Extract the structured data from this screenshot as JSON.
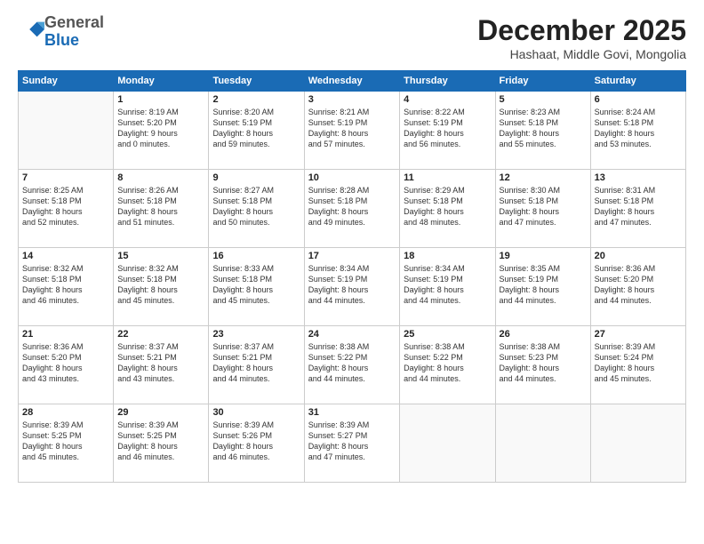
{
  "logo": {
    "general": "General",
    "blue": "Blue"
  },
  "header": {
    "title": "December 2025",
    "subtitle": "Hashaat, Middle Govi, Mongolia"
  },
  "calendar": {
    "columns": [
      "Sunday",
      "Monday",
      "Tuesday",
      "Wednesday",
      "Thursday",
      "Friday",
      "Saturday"
    ],
    "weeks": [
      [
        {
          "day": "",
          "info": ""
        },
        {
          "day": "1",
          "info": "Sunrise: 8:19 AM\nSunset: 5:20 PM\nDaylight: 9 hours\nand 0 minutes."
        },
        {
          "day": "2",
          "info": "Sunrise: 8:20 AM\nSunset: 5:19 PM\nDaylight: 8 hours\nand 59 minutes."
        },
        {
          "day": "3",
          "info": "Sunrise: 8:21 AM\nSunset: 5:19 PM\nDaylight: 8 hours\nand 57 minutes."
        },
        {
          "day": "4",
          "info": "Sunrise: 8:22 AM\nSunset: 5:19 PM\nDaylight: 8 hours\nand 56 minutes."
        },
        {
          "day": "5",
          "info": "Sunrise: 8:23 AM\nSunset: 5:18 PM\nDaylight: 8 hours\nand 55 minutes."
        },
        {
          "day": "6",
          "info": "Sunrise: 8:24 AM\nSunset: 5:18 PM\nDaylight: 8 hours\nand 53 minutes."
        }
      ],
      [
        {
          "day": "7",
          "info": "Sunrise: 8:25 AM\nSunset: 5:18 PM\nDaylight: 8 hours\nand 52 minutes."
        },
        {
          "day": "8",
          "info": "Sunrise: 8:26 AM\nSunset: 5:18 PM\nDaylight: 8 hours\nand 51 minutes."
        },
        {
          "day": "9",
          "info": "Sunrise: 8:27 AM\nSunset: 5:18 PM\nDaylight: 8 hours\nand 50 minutes."
        },
        {
          "day": "10",
          "info": "Sunrise: 8:28 AM\nSunset: 5:18 PM\nDaylight: 8 hours\nand 49 minutes."
        },
        {
          "day": "11",
          "info": "Sunrise: 8:29 AM\nSunset: 5:18 PM\nDaylight: 8 hours\nand 48 minutes."
        },
        {
          "day": "12",
          "info": "Sunrise: 8:30 AM\nSunset: 5:18 PM\nDaylight: 8 hours\nand 47 minutes."
        },
        {
          "day": "13",
          "info": "Sunrise: 8:31 AM\nSunset: 5:18 PM\nDaylight: 8 hours\nand 47 minutes."
        }
      ],
      [
        {
          "day": "14",
          "info": "Sunrise: 8:32 AM\nSunset: 5:18 PM\nDaylight: 8 hours\nand 46 minutes."
        },
        {
          "day": "15",
          "info": "Sunrise: 8:32 AM\nSunset: 5:18 PM\nDaylight: 8 hours\nand 45 minutes."
        },
        {
          "day": "16",
          "info": "Sunrise: 8:33 AM\nSunset: 5:18 PM\nDaylight: 8 hours\nand 45 minutes."
        },
        {
          "day": "17",
          "info": "Sunrise: 8:34 AM\nSunset: 5:19 PM\nDaylight: 8 hours\nand 44 minutes."
        },
        {
          "day": "18",
          "info": "Sunrise: 8:34 AM\nSunset: 5:19 PM\nDaylight: 8 hours\nand 44 minutes."
        },
        {
          "day": "19",
          "info": "Sunrise: 8:35 AM\nSunset: 5:19 PM\nDaylight: 8 hours\nand 44 minutes."
        },
        {
          "day": "20",
          "info": "Sunrise: 8:36 AM\nSunset: 5:20 PM\nDaylight: 8 hours\nand 44 minutes."
        }
      ],
      [
        {
          "day": "21",
          "info": "Sunrise: 8:36 AM\nSunset: 5:20 PM\nDaylight: 8 hours\nand 43 minutes."
        },
        {
          "day": "22",
          "info": "Sunrise: 8:37 AM\nSunset: 5:21 PM\nDaylight: 8 hours\nand 43 minutes."
        },
        {
          "day": "23",
          "info": "Sunrise: 8:37 AM\nSunset: 5:21 PM\nDaylight: 8 hours\nand 44 minutes."
        },
        {
          "day": "24",
          "info": "Sunrise: 8:38 AM\nSunset: 5:22 PM\nDaylight: 8 hours\nand 44 minutes."
        },
        {
          "day": "25",
          "info": "Sunrise: 8:38 AM\nSunset: 5:22 PM\nDaylight: 8 hours\nand 44 minutes."
        },
        {
          "day": "26",
          "info": "Sunrise: 8:38 AM\nSunset: 5:23 PM\nDaylight: 8 hours\nand 44 minutes."
        },
        {
          "day": "27",
          "info": "Sunrise: 8:39 AM\nSunset: 5:24 PM\nDaylight: 8 hours\nand 45 minutes."
        }
      ],
      [
        {
          "day": "28",
          "info": "Sunrise: 8:39 AM\nSunset: 5:25 PM\nDaylight: 8 hours\nand 45 minutes."
        },
        {
          "day": "29",
          "info": "Sunrise: 8:39 AM\nSunset: 5:25 PM\nDaylight: 8 hours\nand 46 minutes."
        },
        {
          "day": "30",
          "info": "Sunrise: 8:39 AM\nSunset: 5:26 PM\nDaylight: 8 hours\nand 46 minutes."
        },
        {
          "day": "31",
          "info": "Sunrise: 8:39 AM\nSunset: 5:27 PM\nDaylight: 8 hours\nand 47 minutes."
        },
        {
          "day": "",
          "info": ""
        },
        {
          "day": "",
          "info": ""
        },
        {
          "day": "",
          "info": ""
        }
      ]
    ]
  }
}
